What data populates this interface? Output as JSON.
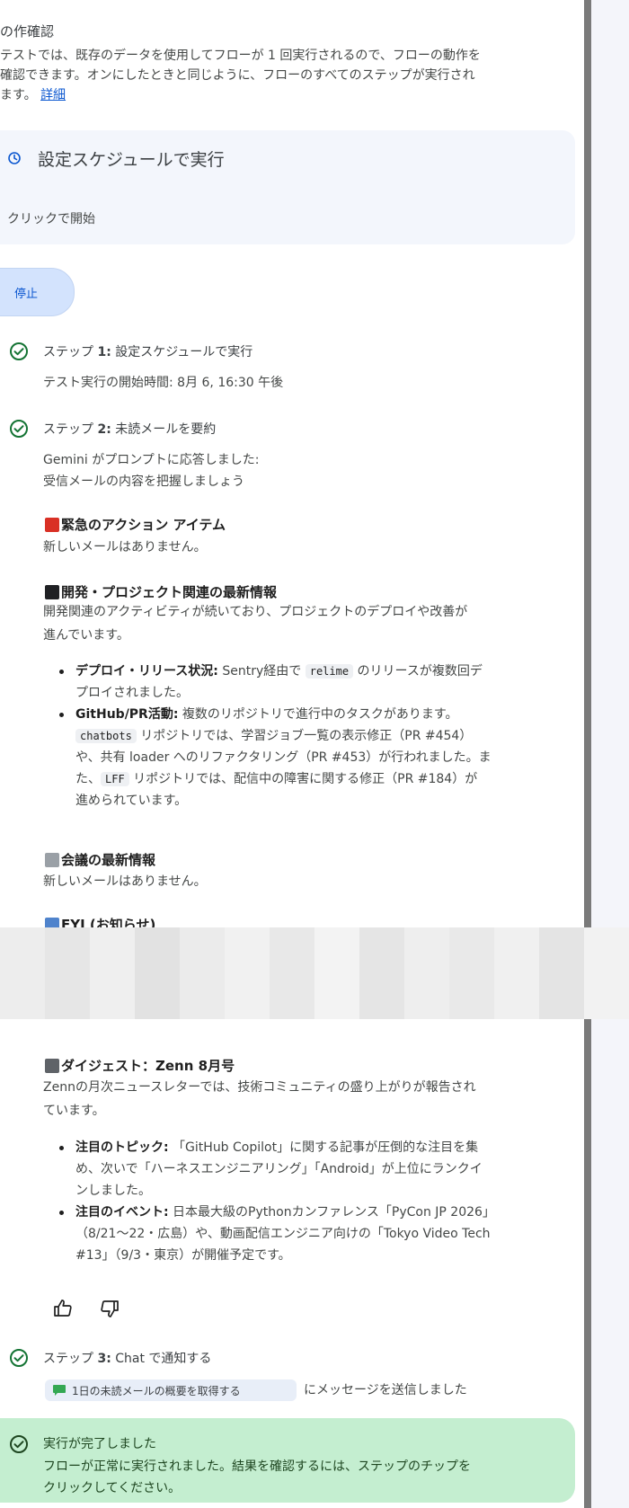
{
  "intro": {
    "title": "の作確認",
    "line1": "テストでは、既存のデータを使用してフローが 1 回実行されるので、フローの動作を",
    "line2": "確認できます。オンにしたときと同じように、フローのすべてのステップが実行され",
    "line3": "ます。",
    "link": "詳細"
  },
  "schedule_card": {
    "icon": "schedule-icon",
    "title": "設定スケジュールで実行",
    "subtitle": "クリックで開始"
  },
  "stop_button": {
    "label": "停止"
  },
  "steps": [
    {
      "prefix": "ステップ ",
      "num": "1:",
      "title": " 設定スケジュールで実行",
      "sub": "テスト実行の開始時間: 8月 6, 16:30 午後"
    },
    {
      "prefix": "ステップ ",
      "num": "2:",
      "title": " 未読メールを要約",
      "sub1": "Gemini がプロンプトに応答しました:",
      "sub2": "受信メールの内容を把握しましょう"
    },
    {
      "prefix": "ステップ ",
      "num": "3:",
      "title": " Chat で通知する"
    }
  ],
  "sections": {
    "urgent": {
      "title": "緊急のアクション アイテム",
      "text": "新しいメールはありません。",
      "color": "#d93025"
    },
    "dev": {
      "title": "開発・プロジェクト関連の最新情報",
      "text1": "開発関連のアクティビティが続いており、プロジェクトのデプロイや改善が",
      "text2": "進んでいます。",
      "color": "#202124",
      "bullet1": {
        "label": "デプロイ・リリース状況:",
        "t1": " Sentry経由で ",
        "code": "relime",
        "t2": " のリリースが複数回デ",
        "t3": "プロイされました。"
      },
      "bullet2": {
        "label": "GitHub/PR活動:",
        "t1": " 複数のリポジトリで進行中のタスクがあります。",
        "code1": "chatbots",
        "t2": " リポジトリでは、学習ジョブ一覧の表示修正（PR #454）",
        "t3": "や、共有 loader へのリファクタリング（PR #453）が行われました。ま",
        "t4": "た、",
        "code2": "LFF",
        "t5": " リポジトリでは、配信中の障害に関する修正（PR #184）が",
        "t6": "進められています。"
      }
    },
    "meeting": {
      "title": "会議の最新情報",
      "text": "新しいメールはありません。",
      "color": "#9aa0a6"
    },
    "fyi": {
      "title": "FYI (お知らせ)",
      "color": "#4f83cc"
    },
    "digest": {
      "title": "ダイジェスト：Zenn 8月号",
      "color": "#5f6368",
      "text1": "Zennの月次ニュースレターでは、技術コミュニティの盛り上がりが報告され",
      "text2": "ています。",
      "bullet1": {
        "label": "注目のトピック:",
        "t1": " 「GitHub Copilot」に関する記事が圧倒的な注目を集",
        "t2": "め、次いで「ハーネスエンジニアリング」「Android」が上位にランクイ",
        "t3": "ンしました。"
      },
      "bullet2": {
        "label": "注目のイベント:",
        "t1": " 日本最大級のPythonカンファレンス「PyCon JP 2026」",
        "t2": "（8/21〜22・広島）や、動画配信エンジニア向けの「Tokyo Video Tech",
        "t3": "#13」（9/3・東京）が開催予定です。"
      }
    }
  },
  "feedback": {
    "like_icon": "thumbs-up-icon",
    "dislike_icon": "thumbs-down-icon"
  },
  "chat_chip": {
    "icon": "chat-icon",
    "label": "1日の未読メールの概要を取得する",
    "after": "にメッセージを送信しました"
  },
  "completion": {
    "title": "実行が完了しました",
    "text1": "フローが正常に実行されました。結果を確認するには、ステップのチップを",
    "text2": "クリックしてください。"
  },
  "colors": {
    "check": "#137333",
    "accent": "#0b57d0",
    "done_bg": "#c4eed0"
  }
}
